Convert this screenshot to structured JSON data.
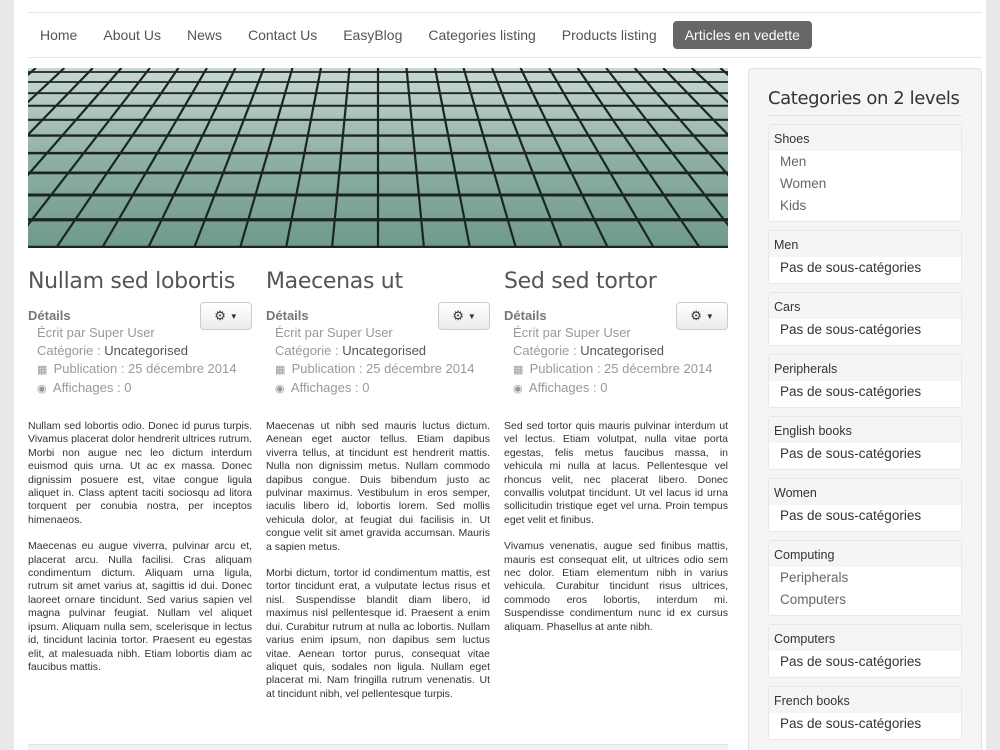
{
  "nav": {
    "items": [
      "Home",
      "About Us",
      "News",
      "Contact Us",
      "EasyBlog",
      "Categories listing",
      "Products listing"
    ],
    "active": "Articles en vedette"
  },
  "articles": [
    {
      "title": "Nullam sed lobortis",
      "details_label": "Détails",
      "author": "Écrit par Super User",
      "category_label": "Catégorie : ",
      "category": "Uncategorised",
      "published": "Publication : 25 décembre 2014",
      "hits": "Affichages : 0",
      "paragraphs": [
        "Nullam sed lobortis odio. Donec id purus turpis. Vivamus placerat dolor hendrerit ultrices rutrum. Morbi non augue nec leo dictum interdum euismod quis urna. Ut ac ex massa. Donec dignissim posuere est, vitae congue ligula aliquet in. Class aptent taciti sociosqu ad litora torquent per conubia nostra, per inceptos himenaeos.",
        "Maecenas eu augue viverra, pulvinar arcu et, placerat arcu. Nulla facilisi. Cras aliquam condimentum dictum. Aliquam urna ligula, rutrum sit amet varius at, sagittis id dui. Donec laoreet ornare tincidunt. Sed varius sapien vel magna pulvinar feugiat. Nullam vel aliquet ipsum. Aliquam nulla sem, scelerisque in lectus id, tincidunt lacinia tortor. Praesent eu egestas elit, at malesuada nibh. Etiam lobortis diam ac faucibus mattis."
      ]
    },
    {
      "title": "Maecenas ut",
      "details_label": "Détails",
      "author": "Écrit par Super User",
      "category_label": "Catégorie : ",
      "category": "Uncategorised",
      "published": "Publication : 25 décembre 2014",
      "hits": "Affichages : 0",
      "paragraphs": [
        "Maecenas ut nibh sed mauris luctus dictum. Aenean eget auctor tellus. Etiam dapibus viverra tellus, at tincidunt est hendrerit mattis. Nulla non dignissim metus. Nullam commodo dapibus congue. Duis bibendum justo ac pulvinar maximus. Vestibulum in eros semper, iaculis libero id, lobortis lorem. Sed mollis vehicula dolor, at feugiat dui facilisis in. Ut congue velit sit amet gravida accumsan. Mauris a sapien metus.",
        "Morbi dictum, tortor id condimentum mattis, est tortor tincidunt erat, a vulputate lectus risus et nisl. Suspendisse blandit diam libero, id maximus nisl pellentesque id. Praesent a enim dui. Curabitur rutrum at nulla ac lobortis. Nullam varius enim ipsum, non dapibus sem luctus vitae. Aenean tortor purus, consequat vitae aliquet quis, sodales non ligula. Nullam eget placerat mi. Nam fringilla rutrum venenatis. Ut at tincidunt nibh, vel pellentesque turpis."
      ]
    },
    {
      "title": "Sed sed tortor",
      "details_label": "Détails",
      "author": "Écrit par Super User",
      "category_label": "Catégorie : ",
      "category": "Uncategorised",
      "published": "Publication : 25 décembre 2014",
      "hits": "Affichages : 0",
      "paragraphs": [
        "Sed sed tortor quis mauris pulvinar interdum ut vel lectus. Etiam volutpat, nulla vitae porta egestas, felis metus faucibus massa, in vehicula mi nulla at lacus. Pellentesque vel rhoncus velit, nec placerat libero. Donec convallis volutpat tincidunt. Ut vel lacus id urna sollicitudin tristique eget vel urna. Proin tempus eget velit et finibus.",
        "Vivamus venenatis, augue sed finibus mattis, mauris est consequat elit, ut ultrices odio sem nec dolor. Etiam elementum nibh in varius vehicula. Curabitur tincidunt risus ultrices, commodo eros lobortis, interdum mi. Suspendisse condimentum nunc id ex cursus aliquam. Phasellus at ante nibh."
      ]
    }
  ],
  "sidebar": {
    "title": "Categories on 2 levels",
    "categories": [
      {
        "name": "Shoes",
        "subs": [
          "Men",
          "Women",
          "Kids"
        ],
        "empty": false
      },
      {
        "name": "Men",
        "subs": [
          "Pas de sous-catégories"
        ],
        "empty": true
      },
      {
        "name": "Cars",
        "subs": [
          "Pas de sous-catégories"
        ],
        "empty": true
      },
      {
        "name": "Peripherals",
        "subs": [
          "Pas de sous-catégories"
        ],
        "empty": true
      },
      {
        "name": "English books",
        "subs": [
          "Pas de sous-catégories"
        ],
        "empty": true
      },
      {
        "name": "Women",
        "subs": [
          "Pas de sous-catégories"
        ],
        "empty": true
      },
      {
        "name": "Computing",
        "subs": [
          "Peripherals",
          "Computers"
        ],
        "empty": false
      },
      {
        "name": "Computers",
        "subs": [
          "Pas de sous-catégories"
        ],
        "empty": true
      },
      {
        "name": "French books",
        "subs": [
          "Pas de sous-catégories"
        ],
        "empty": true
      }
    ]
  },
  "icons": {
    "gear": "gear-icon",
    "caret": "caret-down-icon",
    "calendar": "calendar-icon",
    "eye": "eye-icon"
  },
  "colors": {
    "active_nav_bg": "#666666",
    "hero_glass": "#9fbab0"
  }
}
